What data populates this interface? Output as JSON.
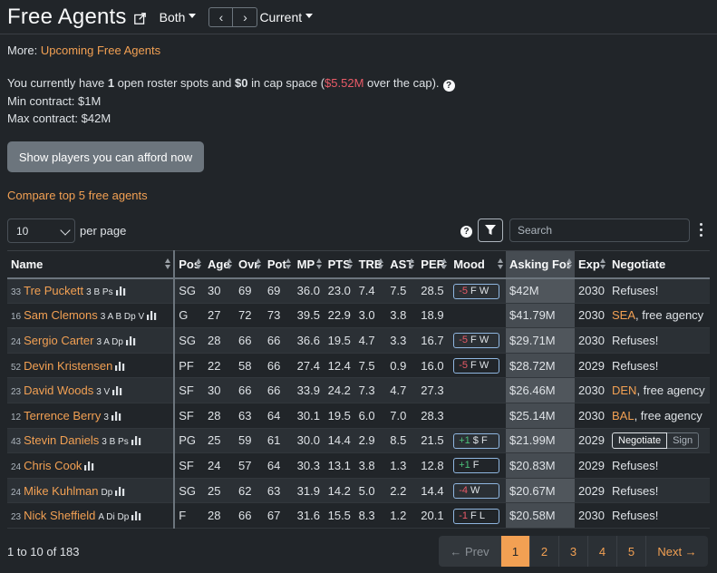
{
  "header": {
    "title": "Free Agents",
    "filter_label": "Both",
    "season_label": "Current",
    "prev_arrow": "‹",
    "next_arrow": "›"
  },
  "more": {
    "label": "More: ",
    "link": "Upcoming Free Agents"
  },
  "cap": {
    "text1": "You currently have ",
    "spots": "1",
    "text2": " open roster spots and ",
    "space": "$0",
    "text3": " in cap space (",
    "over": "$5.52M",
    "text4": " over the cap).",
    "help": "?",
    "min": "Min contract: $1M",
    "max": "Max contract: $42M"
  },
  "afford_button": "Show players you can afford now",
  "compare_link": "Compare top 5 free agents",
  "controls": {
    "per_page_value": "10",
    "per_page_label": "per page",
    "help": "?",
    "search_placeholder": "Search"
  },
  "columns": [
    "Name",
    "Pos",
    "Age",
    "Ovr",
    "Pot",
    "MP",
    "PTS",
    "TRB",
    "AST",
    "PER",
    "Mood",
    "Asking For",
    "Exp",
    "Negotiate"
  ],
  "rows": [
    {
      "rank": "33",
      "name": "Tre Puckett",
      "skills": "3 B Ps",
      "pos": "SG",
      "age": "30",
      "ovr": "69",
      "pot": "69",
      "mp": "36.0",
      "pts": "23.0",
      "trb": "7.4",
      "ast": "7.5",
      "per": "28.5",
      "mood_num": "-5",
      "mood_traits": "F W",
      "mood_sign": "neg",
      "ask": "$42M",
      "exp": "2030",
      "neg_text": "Refuses!",
      "neg_team": ""
    },
    {
      "rank": "16",
      "name": "Sam Clemons",
      "skills": "3 A B Dp V",
      "pos": "G",
      "age": "27",
      "ovr": "72",
      "pot": "73",
      "mp": "39.5",
      "pts": "22.9",
      "trb": "3.0",
      "ast": "3.8",
      "per": "18.9",
      "mood_num": "",
      "mood_traits": "",
      "mood_sign": "",
      "ask": "$41.79M",
      "exp": "2030",
      "neg_text": ", free agency",
      "neg_team": "SEA"
    },
    {
      "rank": "24",
      "name": "Sergio Carter",
      "skills": "3 A Dp",
      "pos": "SG",
      "age": "28",
      "ovr": "66",
      "pot": "66",
      "mp": "36.6",
      "pts": "19.5",
      "trb": "4.7",
      "ast": "3.3",
      "per": "16.7",
      "mood_num": "-5",
      "mood_traits": "F W",
      "mood_sign": "neg",
      "ask": "$29.71M",
      "exp": "2030",
      "neg_text": "Refuses!",
      "neg_team": ""
    },
    {
      "rank": "52",
      "name": "Devin Kristensen",
      "skills": "",
      "pos": "PF",
      "age": "22",
      "ovr": "58",
      "pot": "66",
      "mp": "27.4",
      "pts": "12.4",
      "trb": "7.5",
      "ast": "0.9",
      "per": "16.0",
      "mood_num": "-5",
      "mood_traits": "F W",
      "mood_sign": "neg",
      "ask": "$28.72M",
      "exp": "2029",
      "neg_text": "Refuses!",
      "neg_team": ""
    },
    {
      "rank": "23",
      "name": "David Woods",
      "skills": "3 V",
      "pos": "SF",
      "age": "30",
      "ovr": "66",
      "pot": "66",
      "mp": "33.9",
      "pts": "24.2",
      "trb": "7.3",
      "ast": "4.7",
      "per": "27.3",
      "mood_num": "",
      "mood_traits": "",
      "mood_sign": "",
      "ask": "$26.46M",
      "exp": "2030",
      "neg_text": ", free agency",
      "neg_team": "DEN"
    },
    {
      "rank": "12",
      "name": "Terrence Berry",
      "skills": "3",
      "pos": "SF",
      "age": "28",
      "ovr": "63",
      "pot": "64",
      "mp": "30.1",
      "pts": "19.5",
      "trb": "6.0",
      "ast": "7.0",
      "per": "28.3",
      "mood_num": "",
      "mood_traits": "",
      "mood_sign": "",
      "ask": "$25.14M",
      "exp": "2030",
      "neg_text": ", free agency",
      "neg_team": "BAL"
    },
    {
      "rank": "43",
      "name": "Stevin Daniels",
      "skills": "3 B Ps",
      "pos": "PG",
      "age": "25",
      "ovr": "59",
      "pot": "61",
      "mp": "30.0",
      "pts": "14.4",
      "trb": "2.9",
      "ast": "8.5",
      "per": "21.5",
      "mood_num": "+1",
      "mood_traits": "$ F",
      "mood_sign": "pos",
      "ask": "$21.99M",
      "exp": "2029",
      "neg_text": "",
      "neg_team": "",
      "buttons": [
        "Negotiate",
        "Sign"
      ]
    },
    {
      "rank": "24",
      "name": "Chris Cook",
      "skills": "",
      "pos": "SF",
      "age": "24",
      "ovr": "57",
      "pot": "64",
      "mp": "30.3",
      "pts": "13.1",
      "trb": "3.8",
      "ast": "1.3",
      "per": "12.8",
      "mood_num": "+1",
      "mood_traits": "F",
      "mood_sign": "pos",
      "ask": "$20.83M",
      "exp": "2029",
      "neg_text": "Refuses!",
      "neg_team": ""
    },
    {
      "rank": "24",
      "name": "Mike Kuhlman",
      "skills": "Dp",
      "pos": "SG",
      "age": "25",
      "ovr": "62",
      "pot": "63",
      "mp": "31.9",
      "pts": "14.2",
      "trb": "5.0",
      "ast": "2.2",
      "per": "14.4",
      "mood_num": "-4",
      "mood_traits": "W",
      "mood_sign": "neg",
      "ask": "$20.67M",
      "exp": "2029",
      "neg_text": "Refuses!",
      "neg_team": ""
    },
    {
      "rank": "23",
      "name": "Nick Sheffield",
      "skills": "A Di Dp",
      "pos": "F",
      "age": "28",
      "ovr": "66",
      "pot": "67",
      "mp": "31.6",
      "pts": "15.5",
      "trb": "8.3",
      "ast": "1.2",
      "per": "20.1",
      "mood_num": "-1",
      "mood_traits": "F L",
      "mood_sign": "neg",
      "ask": "$20.58M",
      "exp": "2030",
      "neg_text": "Refuses!",
      "neg_team": ""
    }
  ],
  "footer": {
    "summary": "1 to 10 of 183",
    "prev": "← Prev",
    "pages": [
      "1",
      "2",
      "3",
      "4",
      "5"
    ],
    "active_page": "1",
    "next": "Next →"
  }
}
